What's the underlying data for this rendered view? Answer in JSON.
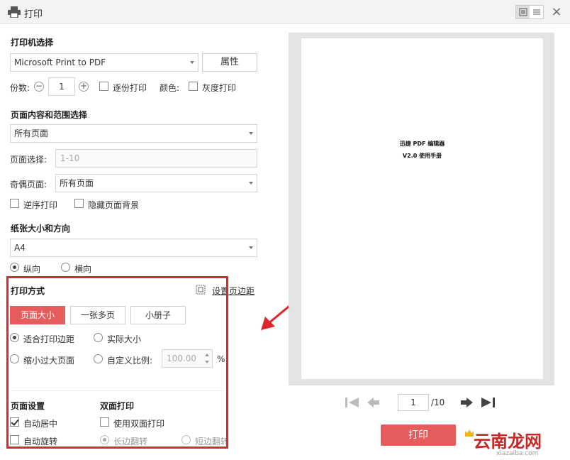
{
  "window": {
    "title": "打印",
    "close_glyph": "×",
    "view_icons": [
      "list-view-icon",
      "detail-view-icon"
    ]
  },
  "printer": {
    "section_title": "打印机选择",
    "selected": "Microsoft Print to PDF",
    "properties_label": "属性",
    "copies_label": "份数:",
    "copies_value": "1",
    "minus_glyph": "−",
    "plus_glyph": "+",
    "collate_label": "逐份打印",
    "color_label": "颜色:",
    "grayscale_label": "灰度打印"
  },
  "range": {
    "section_title": "页面内容和范围选择",
    "content_selected": "所有页面",
    "page_select_label": "页面选择:",
    "page_select_placeholder": "1-10",
    "odd_even_label": "奇偶页面:",
    "odd_even_selected": "所有页面",
    "reverse_label": "逆序打印",
    "hide_bg_label": "隐藏页面背景"
  },
  "paper": {
    "section_title": "纸张大小和方向",
    "size_selected": "A4",
    "portrait_label": "纵向",
    "landscape_label": "横向",
    "orientation": "portrait"
  },
  "print_mode": {
    "section_title": "打印方式",
    "margin_link": "设置页边距",
    "tabs": [
      "页面大小",
      "一张多页",
      "小册子"
    ],
    "active_tab": 0,
    "fit_margin_label": "适合打印边距",
    "actual_size_label": "实际大小",
    "shrink_label": "缩小过大页面",
    "custom_scale_label": "自定义比例:",
    "scale_value": "100.00",
    "scale_unit": "%"
  },
  "page_settings": {
    "section_title": "页面设置",
    "auto_center_label": "自动居中",
    "auto_center_checked": true,
    "auto_rotate_label": "自动旋转",
    "auto_rotate_checked": false
  },
  "duplex": {
    "section_title": "双面打印",
    "use_duplex_label": "使用双面打印",
    "long_edge_label": "长边翻转",
    "short_edge_label": "短边翻转"
  },
  "preview": {
    "line1": "迅捷 PDF 编辑器",
    "line2": "V2.0 使用手册",
    "current_page": "1",
    "total_pages": "/10",
    "first_glyph": "⏮",
    "prev_glyph": "◀",
    "next_glyph": "▶",
    "last_glyph": "⏭"
  },
  "actions": {
    "print_label": "打印"
  },
  "watermark": {
    "text": "云南龙网",
    "url": "xiazaiba.com"
  },
  "colors": {
    "accent": "#e65c5c",
    "highlight_box": "#e0262c"
  }
}
